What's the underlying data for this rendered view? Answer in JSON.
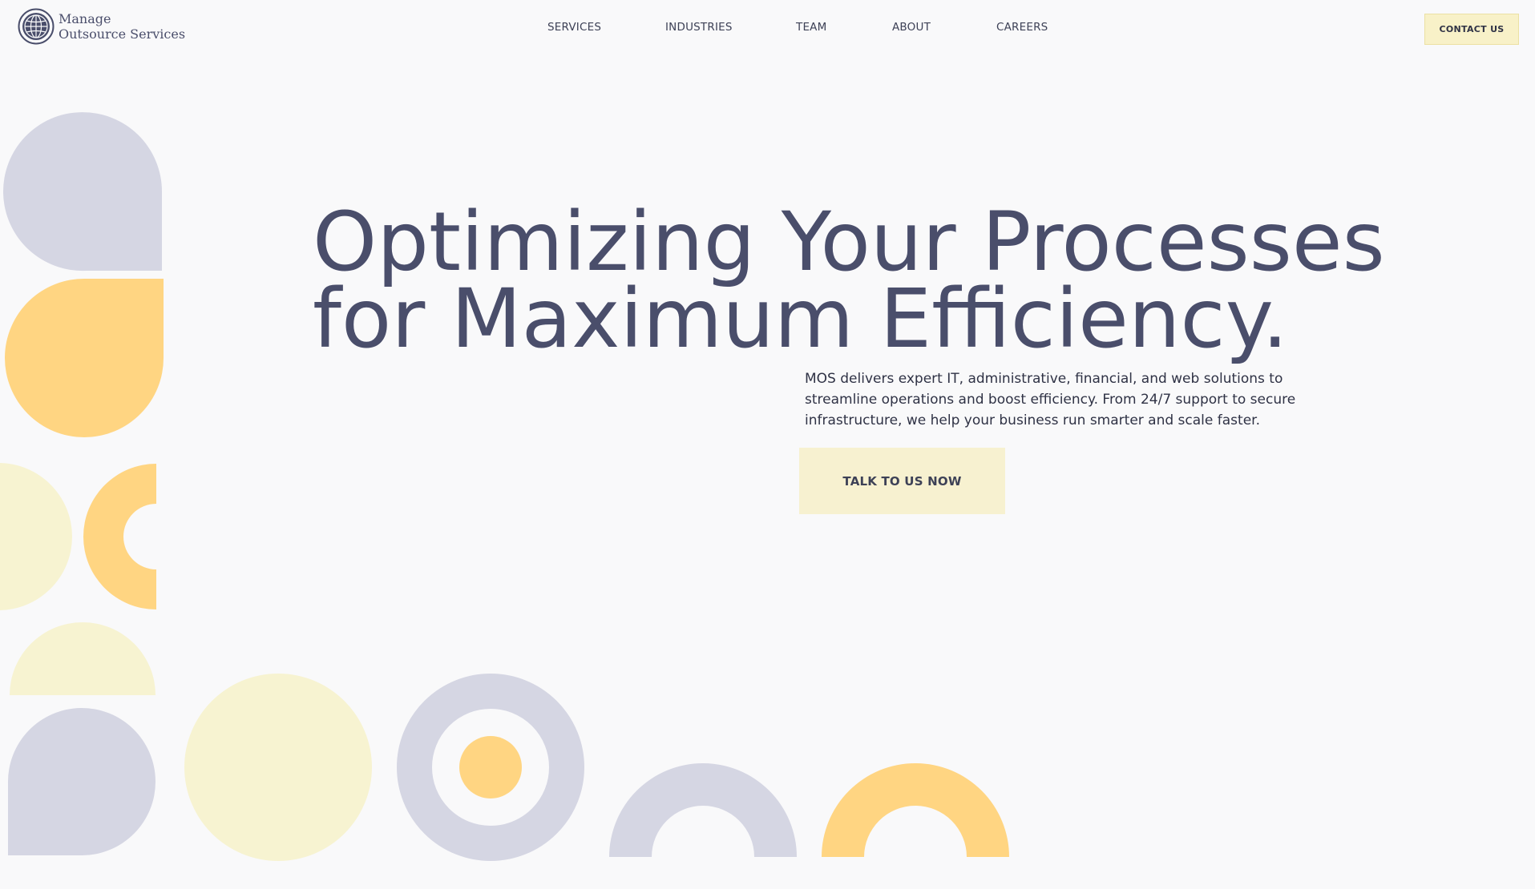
{
  "brand": {
    "name_line1": "Manage",
    "name_line2": "Outsource Services",
    "logo_icon": "globe-icon"
  },
  "nav": {
    "items": [
      {
        "label": "SERVICES"
      },
      {
        "label": "INDUSTRIES"
      },
      {
        "label": "TEAM"
      },
      {
        "label": "ABOUT"
      },
      {
        "label": "CAREERS"
      }
    ],
    "contact_label": "CONTACT US"
  },
  "hero": {
    "title_line1": "Optimizing Your Processes",
    "title_line2": "for Maximum Efficiency.",
    "description": "MOS delivers expert IT, administrative, financial, and web solutions to streamline operations and boost efficiency. From 24/7 support to secure infrastructure, we help your business run smarter and scale faster.",
    "cta_label": "TALK TO US NOW"
  },
  "colors": {
    "background": "#f9f9fa",
    "text": "#4a4e6b",
    "lavender": "#d5d6e3",
    "yellow": "#ffd582",
    "cream": "#f7f3d1",
    "button": "#f8f1c8"
  }
}
